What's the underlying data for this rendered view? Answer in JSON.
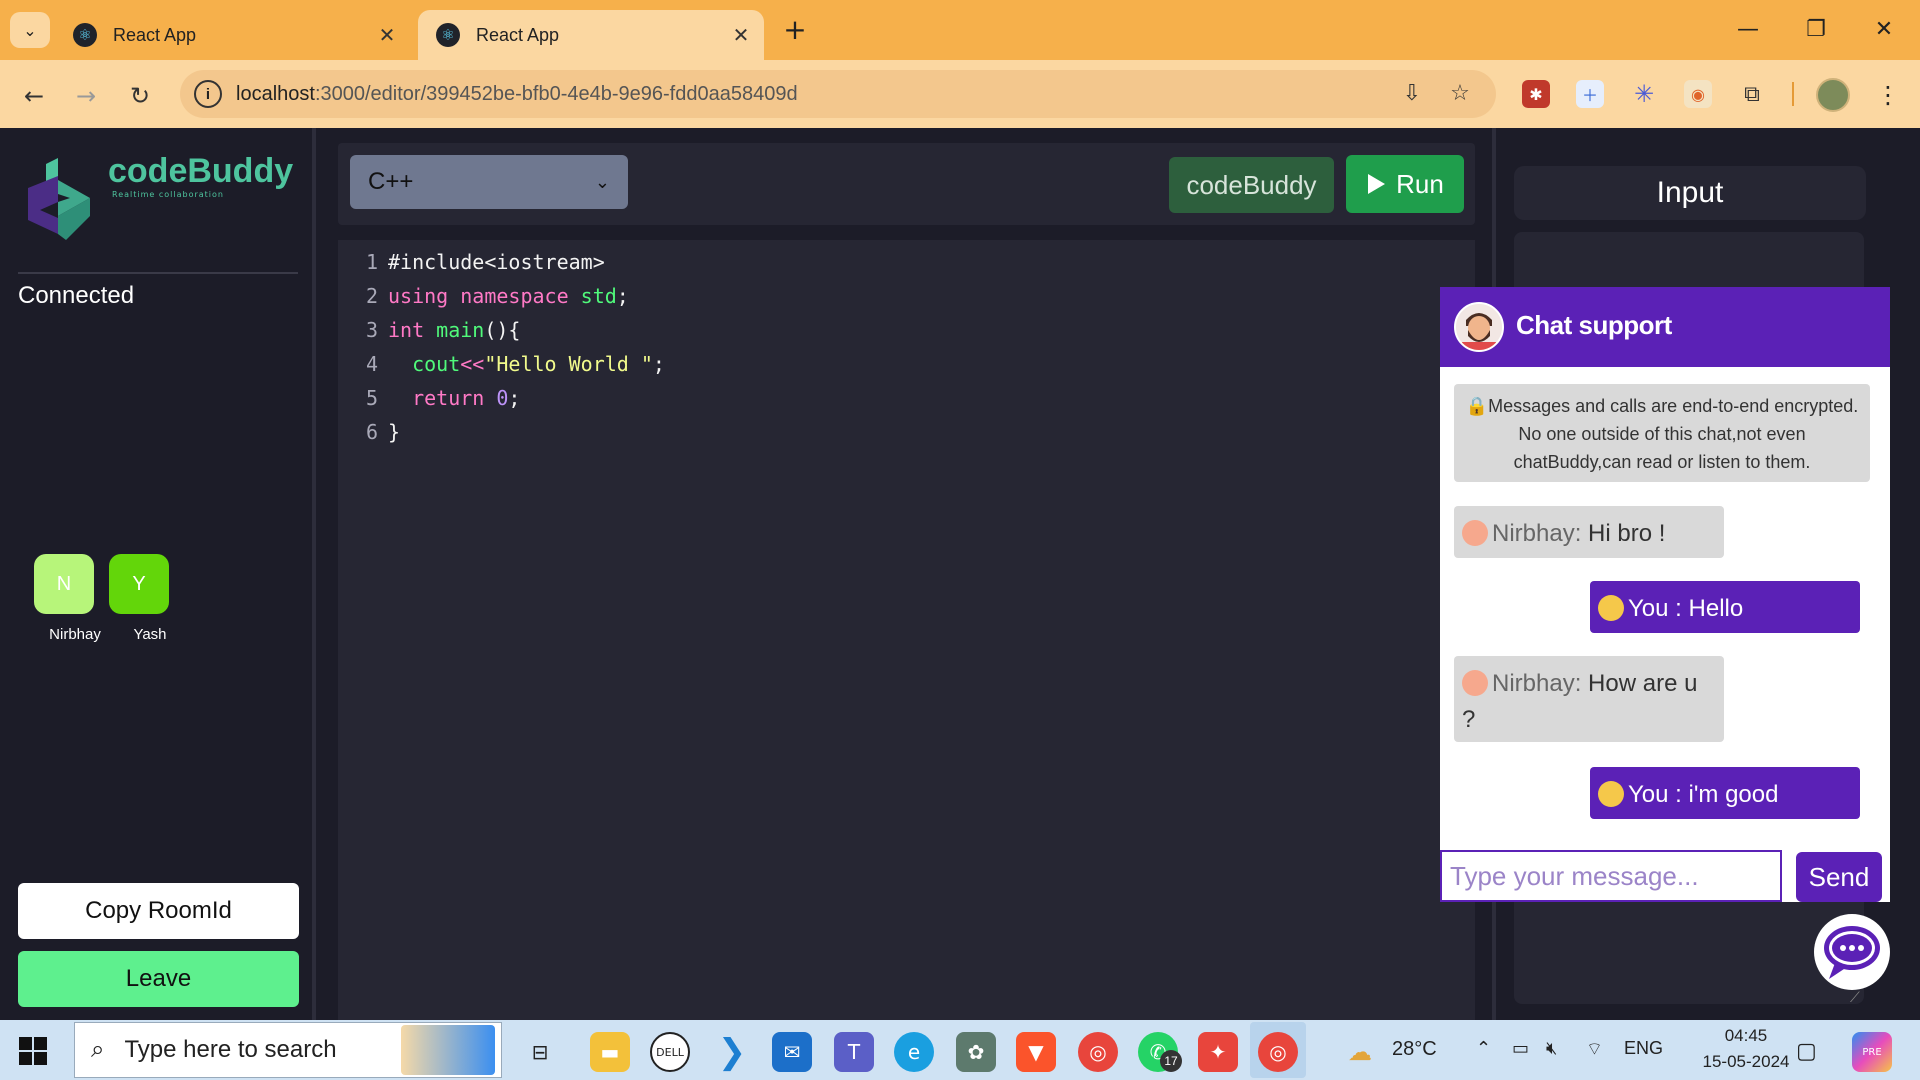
{
  "browser": {
    "tabs": [
      {
        "label": "React App",
        "active": false
      },
      {
        "label": "React App",
        "active": true
      }
    ],
    "new_tab": "+",
    "url_host": "localhost",
    "url_path": ":3000/editor/399452be-bfb0-4e4b-9e96-fdd0aa58409d",
    "window_controls": {
      "minimize": "—",
      "restore": "❐",
      "close": "✕"
    }
  },
  "sidebar": {
    "logo_text": "codeBuddy",
    "logo_tagline": "Realtime collaboration",
    "status": "Connected",
    "clients": [
      {
        "initial": "N",
        "name": "Nirbhay",
        "color": "#b7f57a"
      },
      {
        "initial": "Y",
        "name": "Yash",
        "color": "#63d60a"
      }
    ],
    "copy_button": "Copy RoomId",
    "leave_button": "Leave"
  },
  "editor": {
    "language": "C++",
    "codebuddy_button": "codeBuddy",
    "run_button": "Run",
    "line_numbers": [
      "1",
      "2",
      "3",
      "4",
      "5",
      "6"
    ],
    "lines": [
      [
        {
          "t": "#include<iostream>",
          "c": ""
        }
      ],
      [
        {
          "t": "using ",
          "c": "kw"
        },
        {
          "t": "namespace ",
          "c": "kw"
        },
        {
          "t": "std",
          "c": "ty"
        },
        {
          "t": ";",
          "c": ""
        }
      ],
      [
        {
          "t": "int ",
          "c": "kw"
        },
        {
          "t": "main",
          "c": "fn"
        },
        {
          "t": "(){",
          "c": ""
        }
      ],
      [
        {
          "t": "  cout",
          "c": "ty"
        },
        {
          "t": "<<",
          "c": "kw"
        },
        {
          "t": "\"Hello World \"",
          "c": "st"
        },
        {
          "t": ";",
          "c": ""
        }
      ],
      [
        {
          "t": "  return ",
          "c": "kw"
        },
        {
          "t": "0",
          "c": "nu"
        },
        {
          "t": ";",
          "c": ""
        }
      ],
      [
        {
          "t": "}",
          "c": ""
        }
      ]
    ]
  },
  "input_panel": {
    "title": "Input"
  },
  "chat": {
    "title": "Chat support",
    "notice": "🔒Messages and calls are end-to-end encrypted. No one outside of this chat,not even chatBuddy,can read or listen to them.",
    "messages": [
      {
        "from": "Nirbhay:",
        "text": " Hi bro !",
        "side": "in"
      },
      {
        "from": "You :",
        "text": " Hello",
        "side": "out"
      },
      {
        "from": "Nirbhay:",
        "text": " How are u ?",
        "side": "in"
      },
      {
        "from": "You :",
        "text": " i'm good",
        "side": "out"
      }
    ],
    "input_placeholder": "Type your message...",
    "send_button": "Send"
  },
  "taskbar": {
    "search_placeholder": "Type here to search",
    "weather": "28°C",
    "language": "ENG",
    "time": "04:45",
    "date": "15-05-2024",
    "whatsapp_badge": "17"
  },
  "colors": {
    "accent_purple": "#5b21b6",
    "run_green": "#1f9e4c",
    "leave_green": "#5ef08e",
    "browser_orange": "#f6b04b"
  }
}
